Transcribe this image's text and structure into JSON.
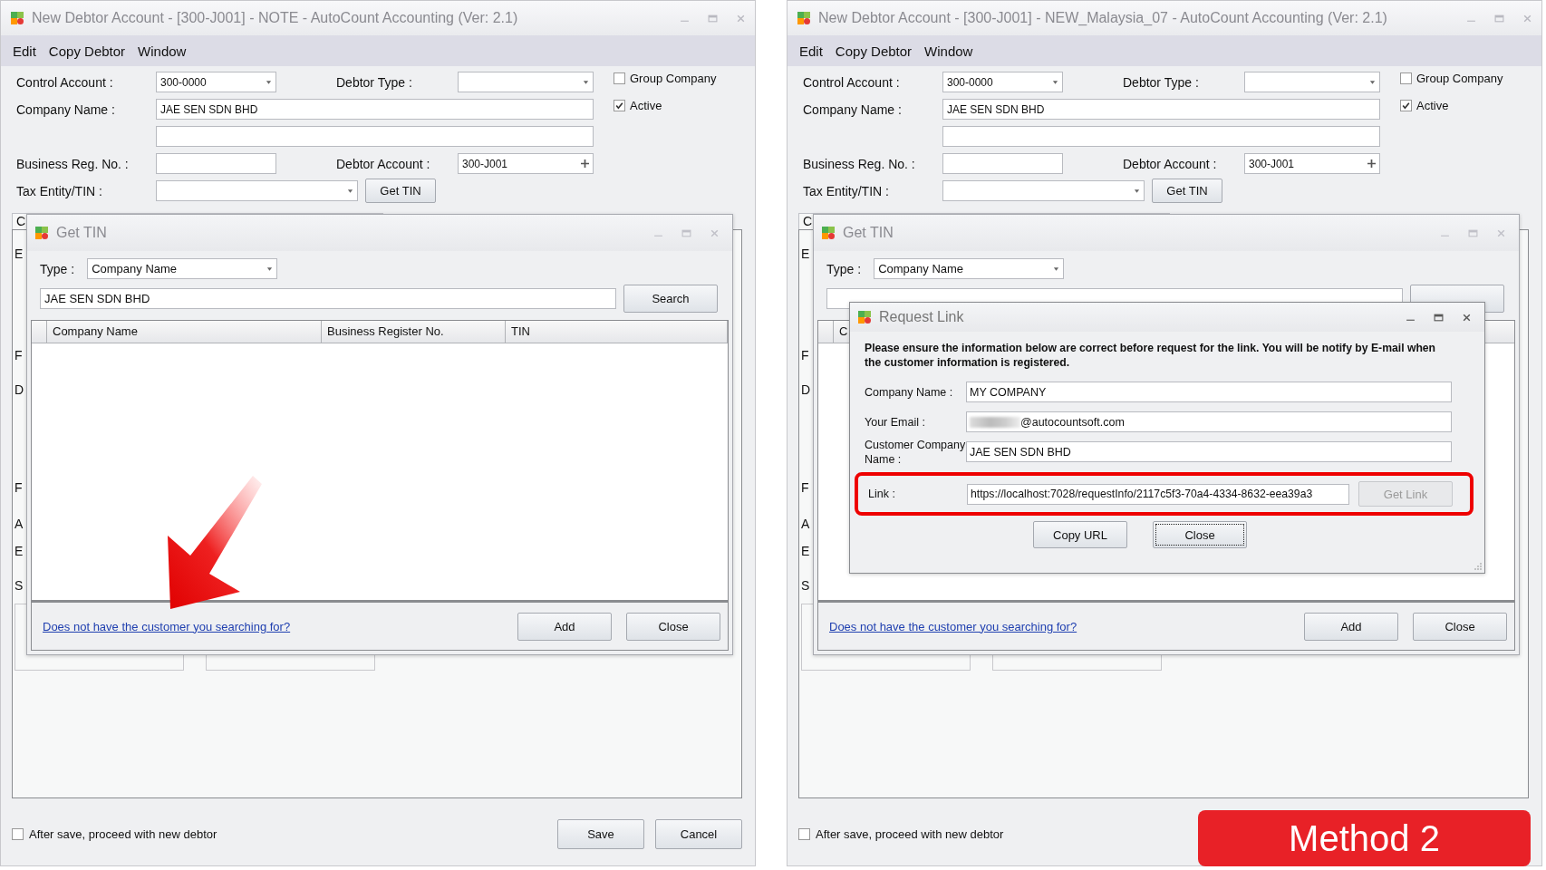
{
  "windows": [
    {
      "title": "New Debtor Account - [300-J001] - NOTE - AutoCount Accounting (Ver: 2.1)",
      "menu": [
        "Edit",
        "Copy Debtor",
        "Window"
      ],
      "form": {
        "control_account_label": "Control Account :",
        "control_account": "300-0000",
        "debtor_type_label": "Debtor Type :",
        "company_name_label": "Company Name :",
        "company_name": "JAE SEN SDN BHD",
        "business_reg_label": "Business Reg. No. :",
        "debtor_account_label": "Debtor Account :",
        "debtor_account": "300-J001",
        "tax_entity_label": "Tax Entity/TIN :",
        "get_tin_button": "Get TIN"
      },
      "checkboxes": [
        {
          "label": "Group Company",
          "checked": false
        },
        {
          "label": "Active",
          "checked": true
        }
      ],
      "tab": {
        "label": "C"
      },
      "panel_letters": [
        "E",
        "F",
        "D",
        "F",
        "A",
        "E",
        "S"
      ],
      "get_tin": {
        "title": "Get TIN",
        "type_label": "Type :",
        "type": "Company Name",
        "search_value": "JAE SEN SDN BHD",
        "search_button": "Search",
        "columns": [
          "Company Name",
          "Business Register No.",
          "TIN"
        ],
        "link": "Does not have the customer you searching for?",
        "buttons": [
          "Add",
          "Close"
        ]
      },
      "annotation": {
        "kind": "arrow"
      },
      "proceed": {
        "label": "After save, proceed with new debtor",
        "checked": false
      },
      "buttons": [
        "Save",
        "Cancel"
      ]
    },
    {
      "title": "New Debtor Account - [300-J001] - NEW_Malaysia_07 - AutoCount Accounting (Ver: 2.1)",
      "menu": [
        "Edit",
        "Copy Debtor",
        "Window"
      ],
      "form": {
        "control_account_label": "Control Account :",
        "control_account": "300-0000",
        "debtor_type_label": "Debtor Type :",
        "company_name_label": "Company Name :",
        "company_name": "JAE SEN SDN BHD",
        "business_reg_label": "Business Reg. No. :",
        "debtor_account_label": "Debtor Account :",
        "debtor_account": "300-J001",
        "tax_entity_label": "Tax Entity/TIN :",
        "get_tin_button": "Get TIN"
      },
      "checkboxes": [
        {
          "label": "Group Company",
          "checked": false
        },
        {
          "label": "Active",
          "checked": true
        }
      ],
      "tab": {
        "label": "C"
      },
      "panel_letters": [
        "E",
        "F",
        "D",
        "F",
        "A",
        "E",
        "S"
      ],
      "get_tin": {
        "title": "Get TIN",
        "type_label": "Type :",
        "type": "Company Name",
        "columns": [
          "C"
        ],
        "link": "Does not have the customer you searching for?",
        "buttons": [
          "Add",
          "Close"
        ]
      },
      "request_link": {
        "title": "Request Link",
        "message": "Please ensure the information below are correct before request for the link. You will be notify by E-mail when the customer information is registered.",
        "fields": [
          {
            "label": "Company Name :",
            "value": "MY COMPANY",
            "redacted": false
          },
          {
            "label": "Your Email :",
            "value": "@autocountsoft.com",
            "redacted": true
          },
          {
            "label": "Customer Company Name :",
            "value": "JAE SEN SDN BHD",
            "redacted": false
          }
        ],
        "link_label": "Link :",
        "link_value": "https://localhost:7028/requestInfo/2117c5f3-70a4-4334-8632-eea39a3",
        "highlighted": true,
        "get_link": {
          "label": "Get Link",
          "disabled": true
        },
        "buttons": [
          {
            "label": "Copy URL",
            "focused": false
          },
          {
            "label": "Close",
            "focused": true
          }
        ]
      },
      "proceed": {
        "label": "After save, proceed with new debtor",
        "checked": false
      },
      "badge": "Method 2"
    }
  ]
}
